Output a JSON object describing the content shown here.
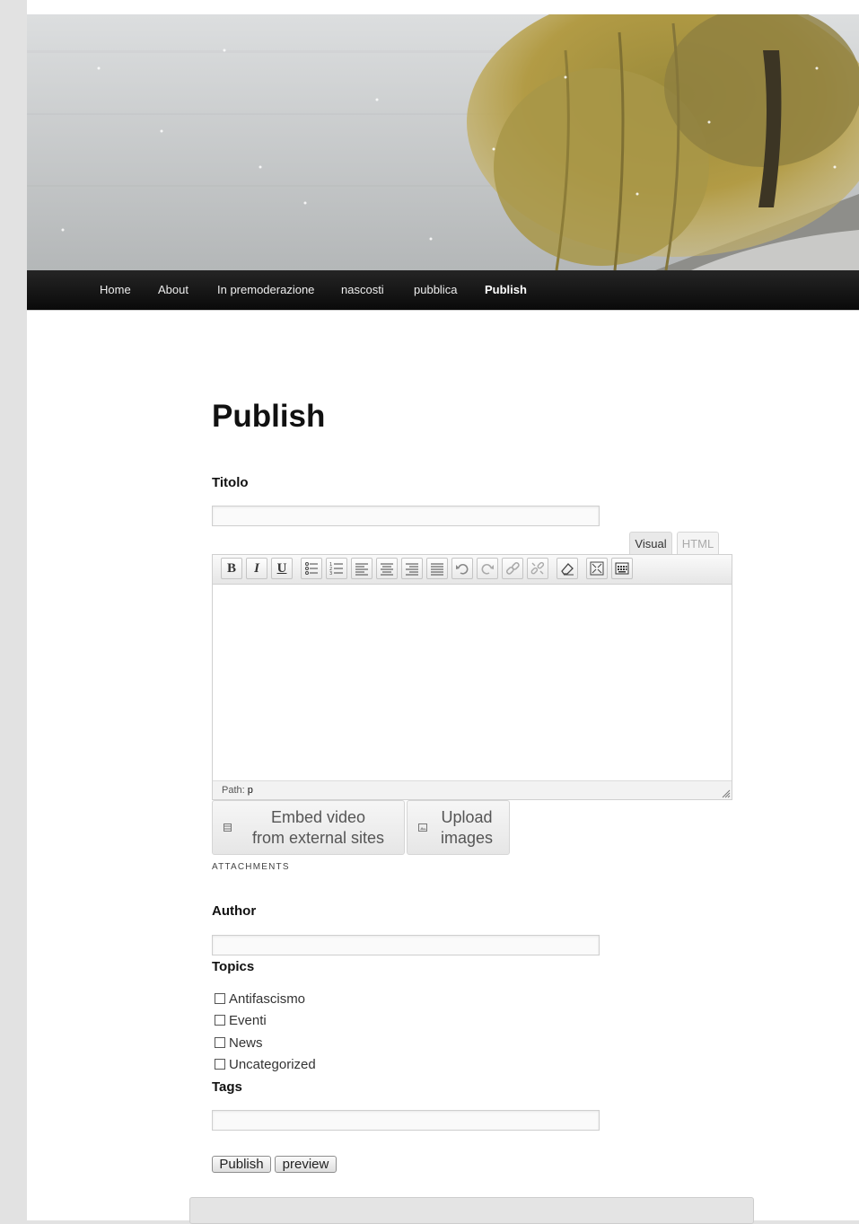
{
  "nav": {
    "items": [
      {
        "label": "Home"
      },
      {
        "label": "About"
      },
      {
        "label": "In premoderazione"
      },
      {
        "label": "nascosti"
      },
      {
        "label": "pubblica"
      },
      {
        "label": "Publish"
      }
    ],
    "current": "Publish"
  },
  "page": {
    "title": "Publish"
  },
  "form": {
    "title_label": "Titolo",
    "title_value": "",
    "editor": {
      "tabs": [
        "Visual",
        "HTML"
      ],
      "active_tab": "Visual",
      "toolbar_buttons": [
        "bold",
        "italic",
        "underline",
        "bullet-list",
        "numbered-list",
        "align-left",
        "align-center",
        "align-right",
        "align-justify",
        "undo",
        "redo",
        "link",
        "unlink",
        "clear-formatting",
        "fullscreen",
        "kitchen-sink"
      ],
      "bold_glyph": "B",
      "italic_glyph": "I",
      "underline_glyph": "U",
      "status_label": "Path:",
      "status_value": "p"
    },
    "media": {
      "embed_line1": "Embed video",
      "embed_line2": "from external sites",
      "upload_line1": "Upload",
      "upload_line2": "images",
      "caption": "ATTACHMENTS"
    },
    "author_label": "Author",
    "author_value": "",
    "topics_label": "Topics",
    "topics": [
      {
        "label": "Antifascismo",
        "checked": false
      },
      {
        "label": "Eventi",
        "checked": false
      },
      {
        "label": "News",
        "checked": false
      },
      {
        "label": "Uncategorized",
        "checked": false
      }
    ],
    "tags_label": "Tags",
    "tags_value": "",
    "publish_button": "Publish",
    "preview_button": "preview"
  },
  "colors": {
    "nav_background": "#111111",
    "page_background": "#ffffff",
    "outer_background": "#e2e2e2"
  }
}
